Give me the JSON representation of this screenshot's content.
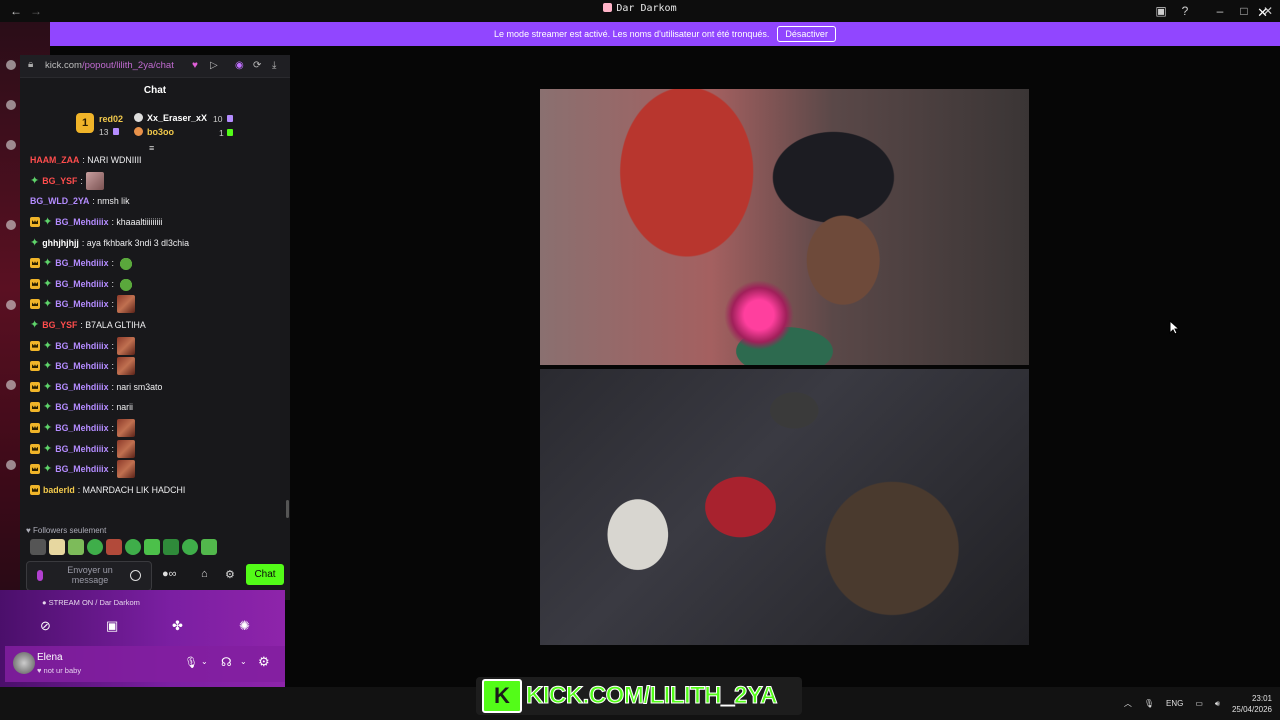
{
  "window": {
    "title": "Dar Darkom",
    "icon": "app-icon"
  },
  "banner": {
    "text": "Le mode streamer est activé. Les noms d'utilisateur ont été tronqués.",
    "button": "Désactiver",
    "color": "#9146ff"
  },
  "popout": {
    "url_domain": "kick.com",
    "url_path": "/popout/lilith_2ya/chat",
    "header": "Chat",
    "leaderboard": {
      "first": {
        "rank": "1",
        "name": "red02",
        "count": "13"
      },
      "second": {
        "name": "Xx_Eraser_xX",
        "count": "10"
      },
      "third": {
        "name": "bo3oo",
        "count": "1"
      }
    },
    "messages": [
      {
        "user": "HAAM_ZAA",
        "color": "#ff4d4d",
        "badges": [],
        "text": ": NARI WDNIIII",
        "emote": ""
      },
      {
        "user": "BG_YSF",
        "color": "#ff4d4d",
        "badges": [
          "star"
        ],
        "text": ":",
        "emote": "cat"
      },
      {
        "user": "BG_WLD_2YA",
        "color": "#b48cff",
        "badges": [],
        "text": ": nmsh lik",
        "emote": ""
      },
      {
        "user": "BG_Mehdiiix",
        "color": "#b48cff",
        "badges": [
          "crown",
          "star"
        ],
        "text": ": khaaaltiiiiiiiii",
        "emote": ""
      },
      {
        "user": "ghhjhjhjj",
        "color": "#ffffff",
        "badges": [
          "star"
        ],
        "text": ": aya fkhbark 3ndi 3 dl3chia",
        "emote": ""
      },
      {
        "user": "BG_Mehdiiix",
        "color": "#b48cff",
        "badges": [
          "crown",
          "star"
        ],
        "text": ":",
        "emote": "frog"
      },
      {
        "user": "BG_Mehdiiix",
        "color": "#b48cff",
        "badges": [
          "crown",
          "star"
        ],
        "text": ":",
        "emote": "frog"
      },
      {
        "user": "BG_Mehdiiix",
        "color": "#b48cff",
        "badges": [
          "crown",
          "star"
        ],
        "text": ":",
        "emote": "face"
      },
      {
        "user": "BG_YSF",
        "color": "#ff4d4d",
        "badges": [
          "star"
        ],
        "text": ": B7ALA GLTIHA",
        "emote": ""
      },
      {
        "user": "BG_Mehdiiix",
        "color": "#b48cff",
        "badges": [
          "crown",
          "star"
        ],
        "text": ":",
        "emote": "face"
      },
      {
        "user": "BG_Mehdiiix",
        "color": "#b48cff",
        "badges": [
          "crown",
          "star"
        ],
        "text": ":",
        "emote": "face"
      },
      {
        "user": "BG_Mehdiiix",
        "color": "#b48cff",
        "badges": [
          "crown",
          "star"
        ],
        "text": ": nari sm3ato",
        "emote": ""
      },
      {
        "user": "BG_Mehdiiix",
        "color": "#b48cff",
        "badges": [
          "crown",
          "star"
        ],
        "text": ": narii",
        "emote": ""
      },
      {
        "user": "BG_Mehdiiix",
        "color": "#b48cff",
        "badges": [
          "crown",
          "star"
        ],
        "text": ":",
        "emote": "face"
      },
      {
        "user": "BG_Mehdiiix",
        "color": "#b48cff",
        "badges": [
          "crown",
          "star"
        ],
        "text": ":",
        "emote": "face"
      },
      {
        "user": "BG_Mehdiiix",
        "color": "#b48cff",
        "badges": [
          "crown",
          "star"
        ],
        "text": ":",
        "emote": "face"
      },
      {
        "user": "baderld",
        "color": "#f2c94c",
        "badges": [
          "crown"
        ],
        "text": ": MANRDACH LIK HADCHI",
        "emote": ""
      }
    ],
    "followers_only": "Followers seulement",
    "input_placeholder": "Envoyer un message",
    "send_button": "Chat",
    "accent": "#53fc18"
  },
  "discord": {
    "stream_status": "STREAM ON / Dar Darkom",
    "user_name": "Elena",
    "user_status": "not ur baby"
  },
  "overlay": {
    "logo_text": "KICK.COM/LILITH_2YA"
  },
  "taskbar": {
    "language": "ENG",
    "time": "23:01",
    "date": "25/04/2026"
  }
}
